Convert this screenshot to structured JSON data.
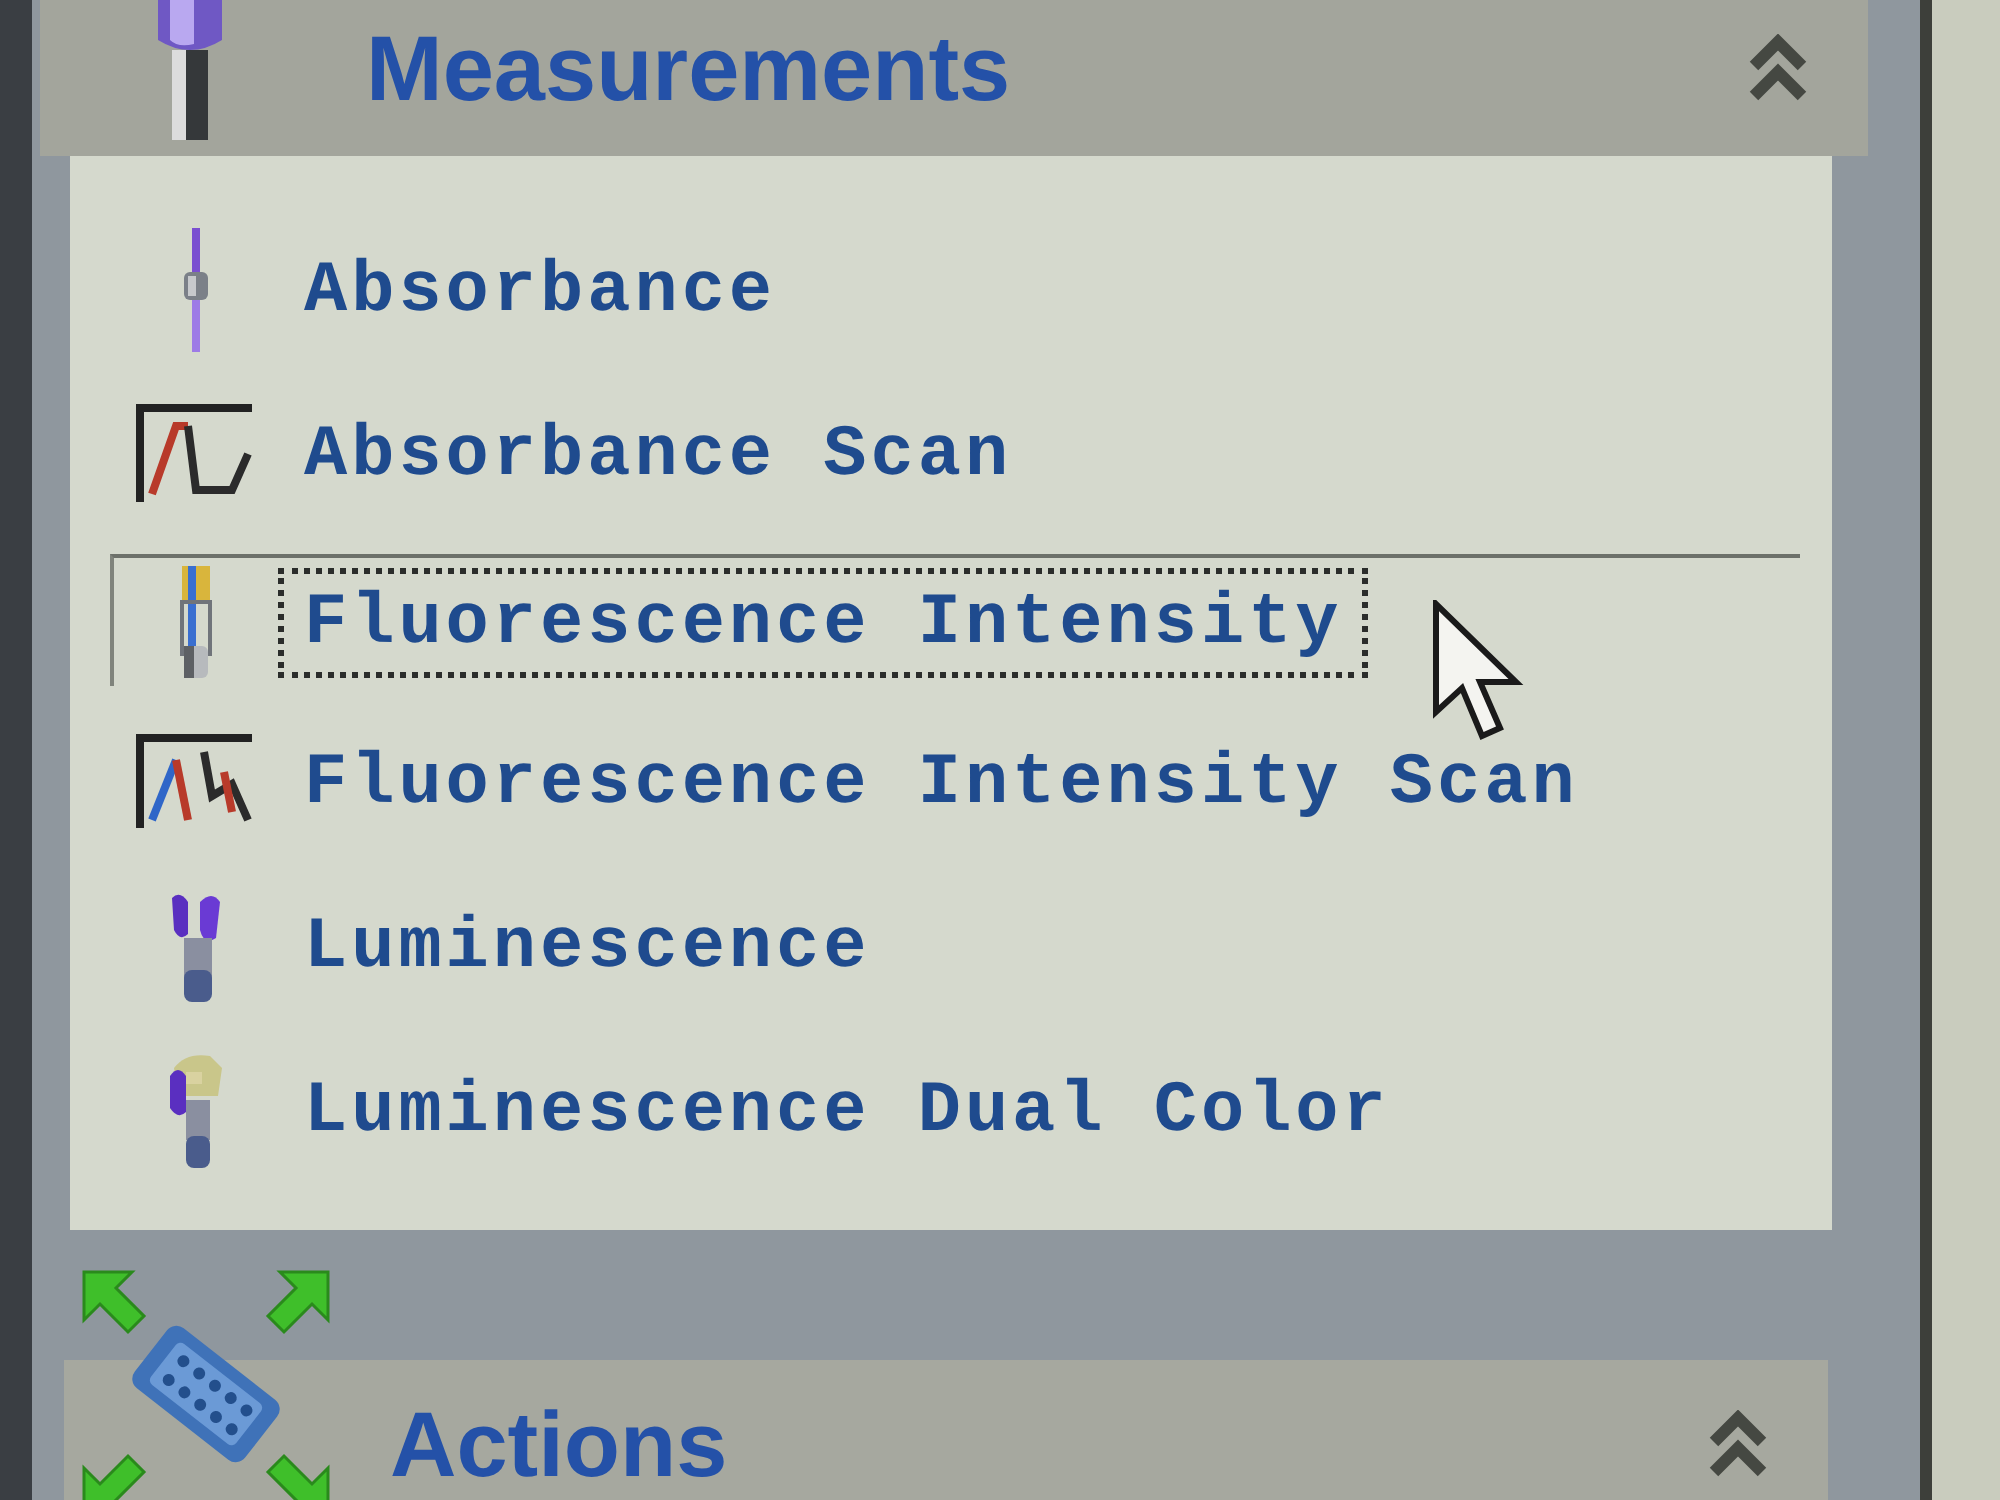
{
  "sections": [
    {
      "title": "Measurements",
      "kind": "probe",
      "expanded": true,
      "items": [
        {
          "label": "Absorbance",
          "kind": "absorbance",
          "selected": false
        },
        {
          "label": "Absorbance Scan",
          "kind": "abscan",
          "selected": false
        },
        {
          "label": "Fluorescence Intensity",
          "kind": "fluorescence",
          "selected": true
        },
        {
          "label": "Fluorescence Intensity Scan",
          "kind": "flscan",
          "selected": false
        },
        {
          "label": "Luminescence",
          "kind": "luminescence",
          "selected": false
        },
        {
          "label": "Luminescence Dual Color",
          "kind": "dualcolor",
          "selected": false
        }
      ]
    },
    {
      "title": "Actions",
      "kind": "plate",
      "expanded": true
    }
  ]
}
